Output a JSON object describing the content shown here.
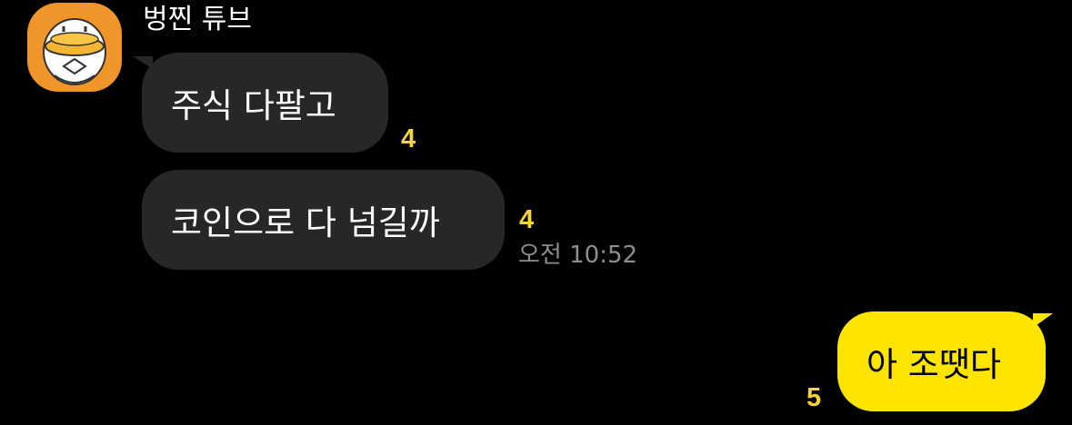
{
  "sender": {
    "name": "벙찐 튜브"
  },
  "messages": [
    {
      "text": "주식 다팔고",
      "unread": "4"
    },
    {
      "text": "코인으로 다 넘길까",
      "unread": "4",
      "time": "오전 10:52"
    }
  ],
  "my_message": {
    "text": "아 조땟다",
    "unread": "5"
  },
  "colors": {
    "background": "#000000",
    "incoming_bubble": "#272727",
    "outgoing_bubble": "#fee500",
    "unread_count": "#f5d33b",
    "avatar_bg": "#f0952a"
  },
  "icons": {
    "avatar": "duck-character-avatar-icon"
  }
}
